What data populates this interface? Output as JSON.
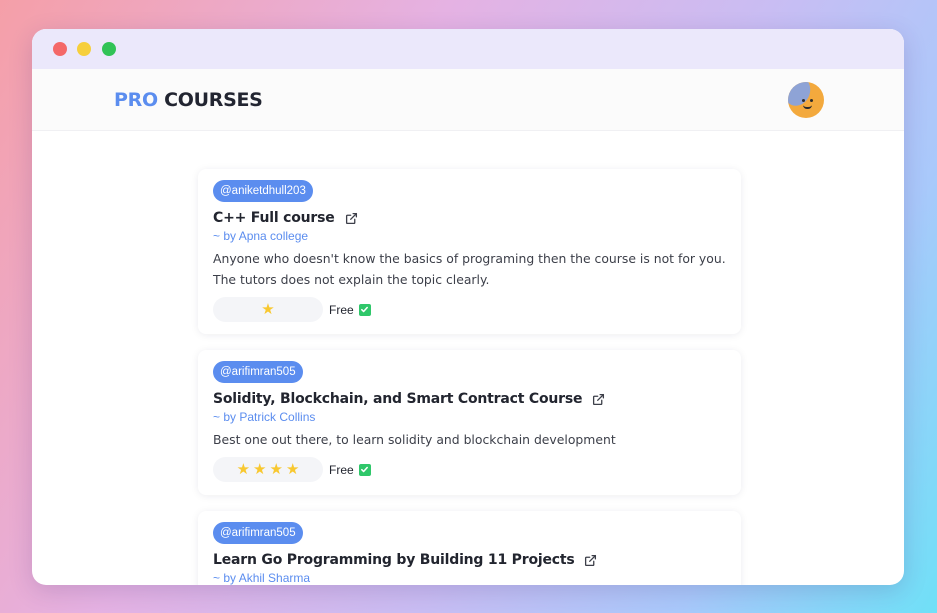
{
  "brand": {
    "pro": "PRO",
    "courses": "COURSES"
  },
  "colors": {
    "accent": "#5b8def",
    "star": "#f8c830",
    "check": "#2fc76a"
  },
  "courses": [
    {
      "user": "@aniketdhull203",
      "title": "C++ Full course",
      "author": "~ by Apna college",
      "review": "Anyone who doesn't know the basics of programing then the course is not for you. The tutors does not explain the topic clearly.",
      "rating": 1,
      "price": "Free"
    },
    {
      "user": "@arifimran505",
      "title": "Solidity, Blockchain, and Smart Contract Course",
      "author": "~ by Patrick Collins",
      "review": "Best one out there, to learn solidity and blockchain development",
      "rating": 4,
      "price": "Free"
    },
    {
      "user": "@arifimran505",
      "title": "Learn Go Programming by Building 11 Projects",
      "author": "~ by Akhil Sharma",
      "review": "",
      "rating": null,
      "price": ""
    }
  ]
}
